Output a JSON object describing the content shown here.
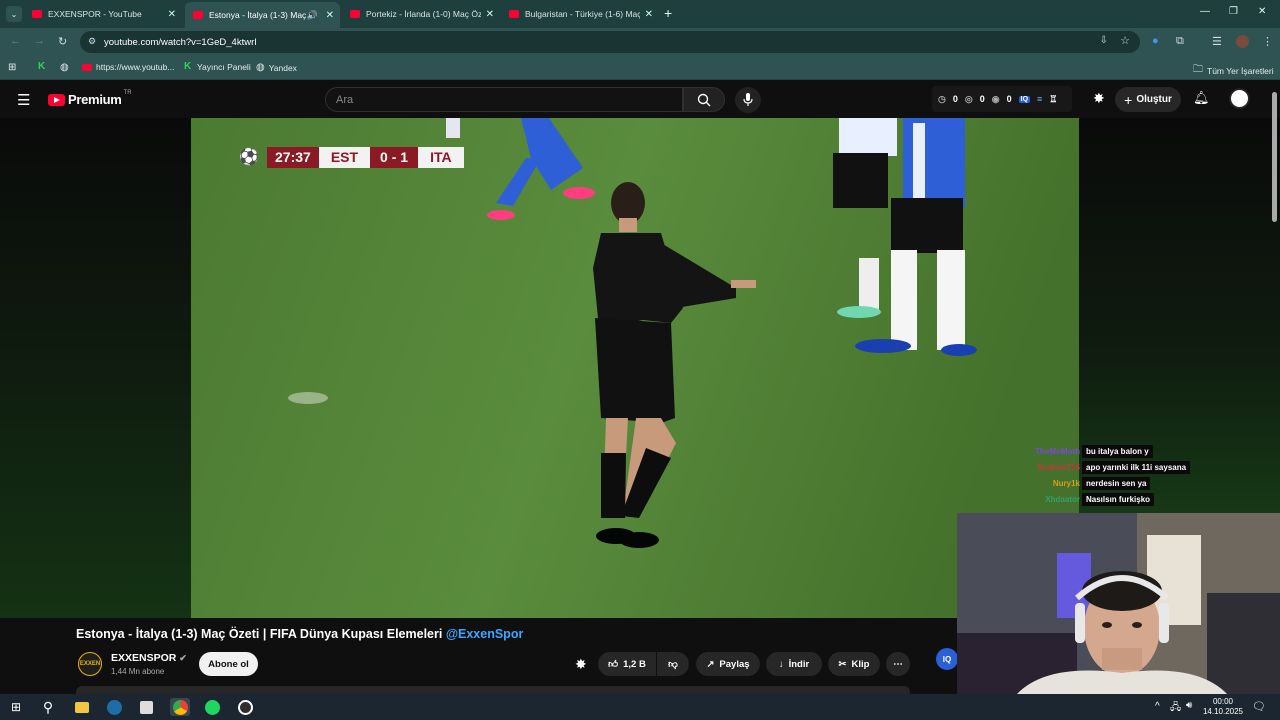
{
  "browser": {
    "tabs": [
      {
        "title": "EXXENSPOR - YouTube",
        "active": false
      },
      {
        "title": "Estonya - İtalya (1-3) Maç Ö",
        "active": true
      },
      {
        "title": "Portekiz - İrlanda (1-0) Maç Öze",
        "active": false
      },
      {
        "title": "Bulgaristan - Türkiye (1-6) Maç",
        "active": false
      }
    ],
    "url": "youtube.com/watch?v=1GeD_4ktwrI",
    "bookmarks": [
      {
        "label": "https://www.youtub..."
      },
      {
        "label": "Yayıncı Paneli"
      },
      {
        "label": "Yandex"
      }
    ],
    "all_bookmarks_label": "Tüm Yer İşaretleri"
  },
  "youtube": {
    "logo_text": "Premium",
    "logo_region": "TR",
    "search_placeholder": "Ara",
    "header_counters": [
      "0",
      "0",
      "0"
    ],
    "create_label": "Oluştur"
  },
  "video": {
    "scorebug": {
      "time": "27:37",
      "home": "EST",
      "score": "0 - 1",
      "away": "ITA"
    },
    "title": "Estonya - İtalya (1-3) Maç Özeti | FIFA Dünya Kupası Elemeleri",
    "handle": "@ExxenSpor"
  },
  "chat": [
    {
      "user": "TheMoMoth",
      "message": "bu italya balon y",
      "color": "#7d4ad4"
    },
    {
      "user": "İbrahim715",
      "message": "apo yarınki ilk 11i saysana",
      "color": "#c4373f"
    },
    {
      "user": "Nury1k",
      "message": "nerdesin sen ya",
      "color": "#d4a017"
    },
    {
      "user": "Xhdaator",
      "message": "Nasılsın furkişko",
      "color": "#2fa26a"
    }
  ],
  "channel": {
    "name": "EXXENSPOR",
    "subscribers": "1,44 Mn abone",
    "subscribe_label": "Abone ol",
    "avatar_text": "EXXEN"
  },
  "actions": {
    "likes": "1,2 B",
    "share": "Paylaş",
    "download": "İndir",
    "clip": "Klip"
  },
  "taskbar": {
    "time": "00:00",
    "date": "14.10.2025"
  }
}
